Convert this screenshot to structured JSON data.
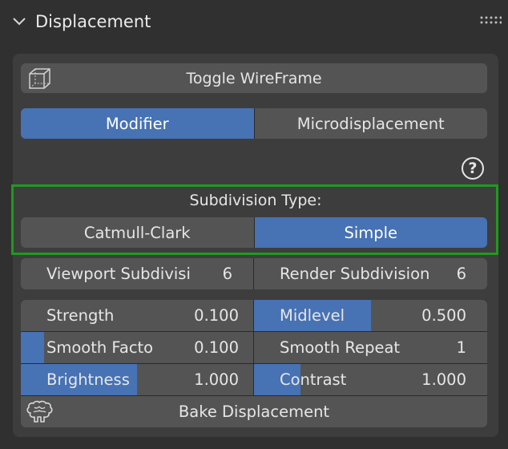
{
  "panel": {
    "title": "Displacement",
    "icon_header": "chevron-down-icon",
    "icon_grip": "drag-grip-icon"
  },
  "toggle_wireframe": {
    "label": "Toggle WireFrame",
    "icon": "wireframe-cube-icon"
  },
  "mode_tabs": {
    "modifier": "Modifier",
    "microdisplacement": "Microdisplacement",
    "selected": "Modifier"
  },
  "help": {
    "glyph": "?"
  },
  "subdivision_type": {
    "label": "Subdivision Type:",
    "options": [
      "Catmull-Clark",
      "Simple"
    ],
    "selected": "Simple"
  },
  "subdivisions": {
    "viewport": {
      "label": "Viewport Subdivisi",
      "value": "6"
    },
    "render": {
      "label": "Render Subdivision",
      "value": "6"
    }
  },
  "params": {
    "strength": {
      "label": "Strength",
      "value": "0.100",
      "fill": 0.0
    },
    "midlevel": {
      "label": "Midlevel",
      "value": "0.500",
      "fill": 0.5
    },
    "smooth_factor": {
      "label": "Smooth Facto",
      "value": "0.100",
      "fill": 0.1
    },
    "smooth_repeat": {
      "label": "Smooth Repeat",
      "value": "1",
      "fill": 0.0
    },
    "brightness": {
      "label": "Brightness",
      "value": "1.000",
      "fill": 0.5
    },
    "contrast": {
      "label": "Contrast",
      "value": "1.000",
      "fill": 0.2
    }
  },
  "bake": {
    "label": "Bake Displacement",
    "icon": "brain-icon"
  },
  "colors": {
    "accent": "#4772b3",
    "button": "#545454",
    "panel": "#3d3d3d",
    "highlight": "#1f9a1f"
  }
}
